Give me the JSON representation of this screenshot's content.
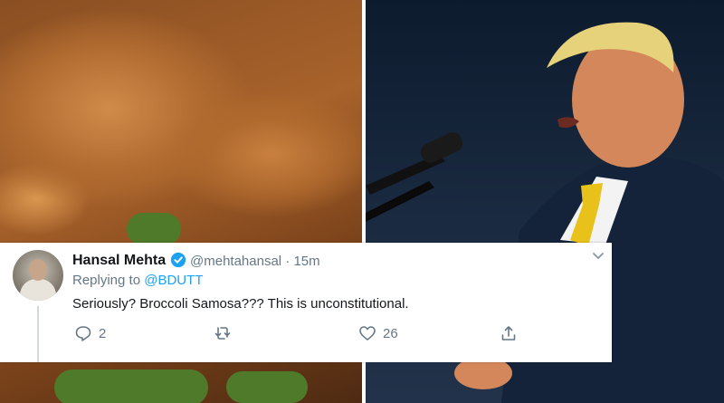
{
  "tweet": {
    "author_name": "Hansal Mehta",
    "handle_time": "@mehtahansal · 15m",
    "replying_prefix": "Replying to",
    "replying_to": "@BDUTT",
    "text": "Seriously? Broccoli Samosa??? This is unconstitutional.",
    "reply_count": "2",
    "retweet_count": "",
    "like_count": "26"
  },
  "icons": [
    "verified-badge-icon",
    "chevron-down-icon",
    "reply-icon",
    "retweet-icon",
    "like-icon",
    "share-icon"
  ],
  "colors": {
    "brand_blue": "#1da1f2",
    "text_primary": "#14171a",
    "text_secondary": "#657786",
    "tie_yellow": "#e8c21a"
  }
}
